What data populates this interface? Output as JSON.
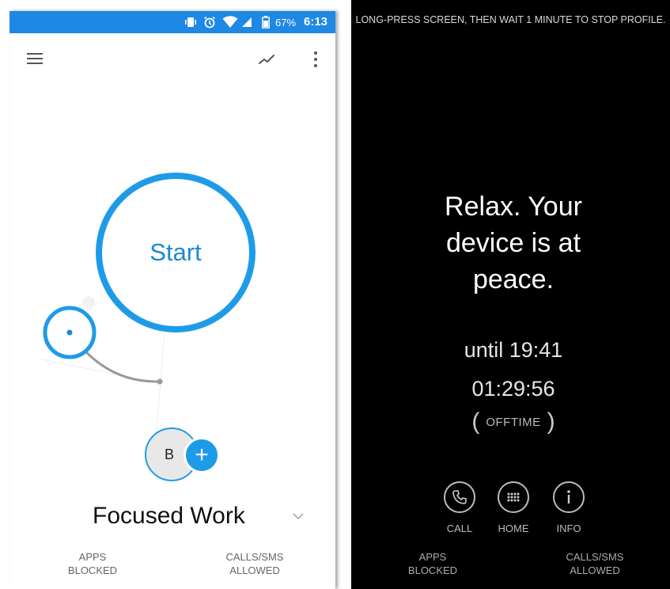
{
  "left_screen": {
    "status_bar": {
      "battery_percent": "67%",
      "time": "6:13",
      "icons": [
        "vibrate-icon",
        "alarm-icon",
        "wifi-icon",
        "signal-icon",
        "battery-icon"
      ],
      "color": "#1e88e5"
    },
    "toolbar": {
      "menu_icon": "menu-icon",
      "stats_icon": "trend-icon",
      "more_icon": "more-vert-icon"
    },
    "start_button": {
      "label": "Start",
      "color": "#1e9be8"
    },
    "profile": {
      "avatar_letter": "B",
      "add_icon": "+",
      "name": "Focused Work",
      "dropdown_icon": "chevron-down-icon"
    },
    "footer": {
      "apps_line1": "APPS",
      "apps_line2": "BLOCKED",
      "calls_line1": "CALLS/SMS",
      "calls_line2": "ALLOWED"
    }
  },
  "right_screen": {
    "hint": "LONG-PRESS SCREEN, THEN WAIT 1 MINUTE TO STOP PROFILE.",
    "message_line1": "Relax. Your",
    "message_line2": "device is at",
    "message_line3": "peace.",
    "until": "until 19:41",
    "countdown": "01:29:56",
    "app_name": "OFFTIME",
    "paren_open": "(",
    "paren_close": ")",
    "buttons": [
      {
        "label": "CALL",
        "icon": "phone-icon"
      },
      {
        "label": "HOME",
        "icon": "grid-icon"
      },
      {
        "label": "INFO",
        "icon": "info-icon"
      }
    ],
    "footer": {
      "apps_line1": "APPS",
      "apps_line2": "BLOCKED",
      "calls_line1": "CALLS/SMS",
      "calls_line2": "ALLOWED"
    }
  }
}
